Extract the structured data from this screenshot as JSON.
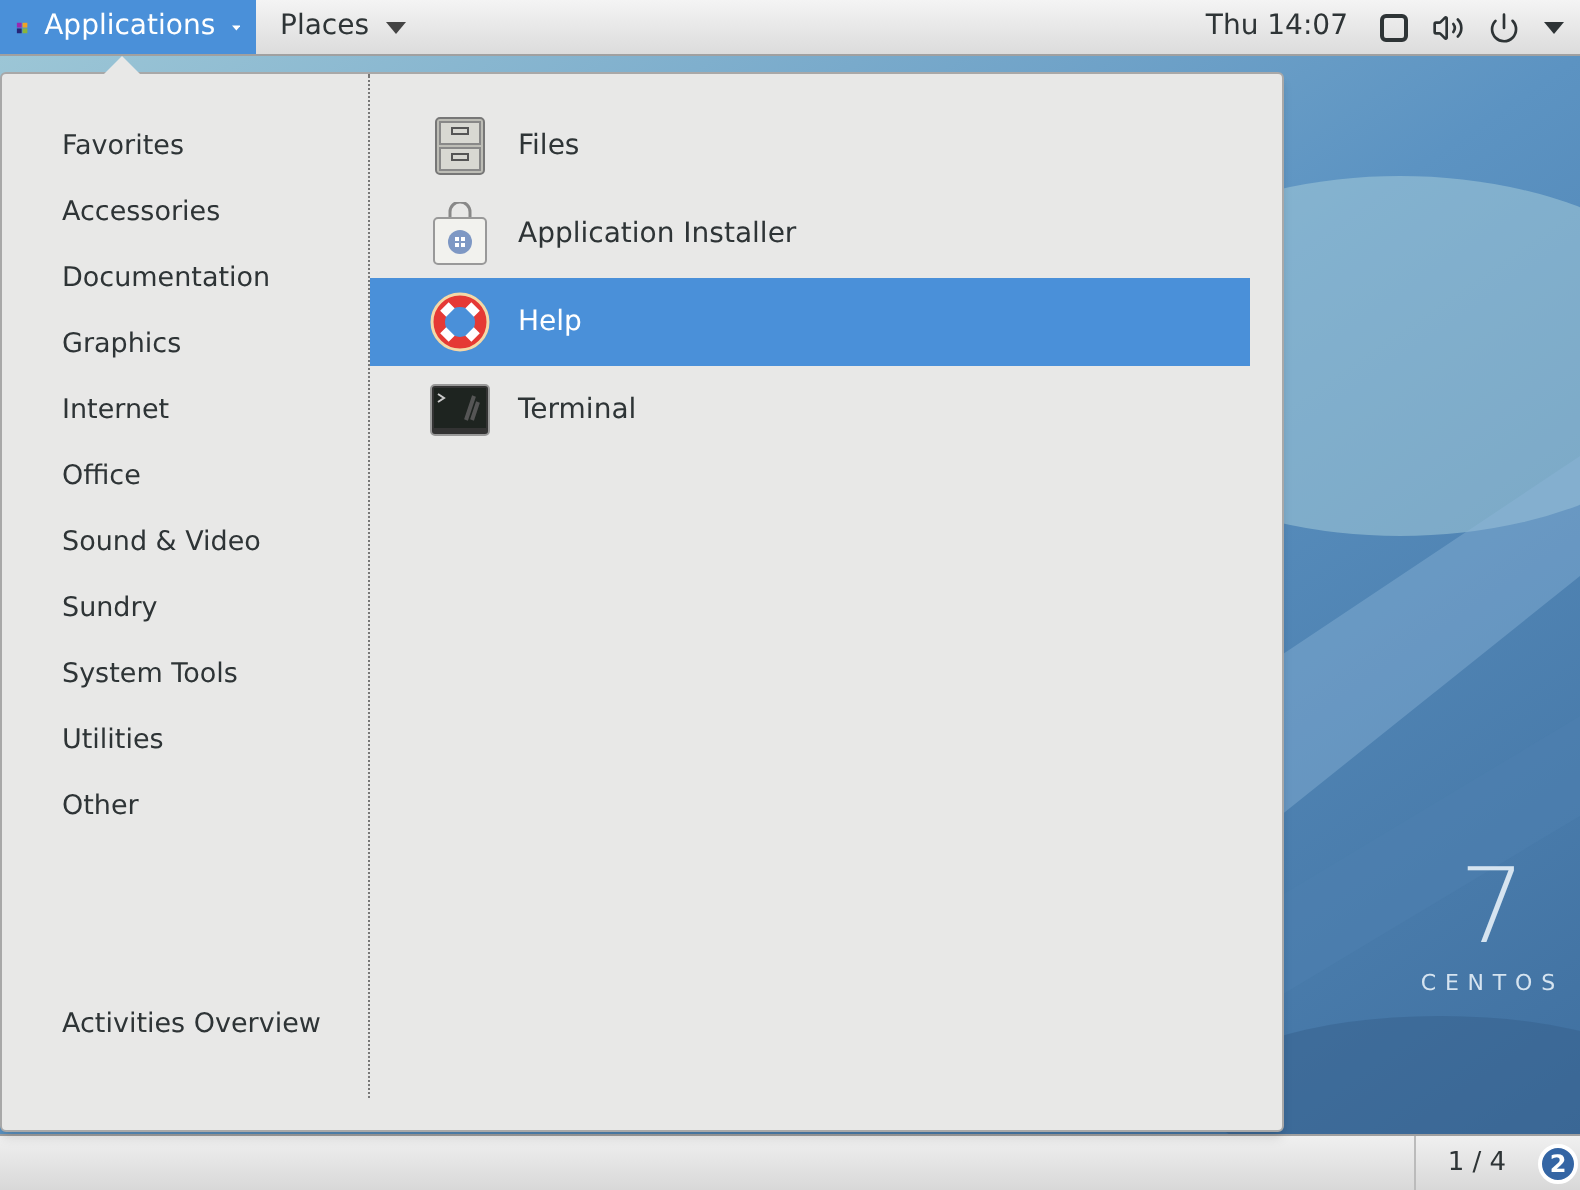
{
  "top_bar": {
    "applications": {
      "label": "Applications",
      "selected": true
    },
    "places": {
      "label": "Places",
      "selected": false
    },
    "clock": "Thu 14:07"
  },
  "menu": {
    "categories": [
      {
        "label": "Favorites"
      },
      {
        "label": "Accessories"
      },
      {
        "label": "Documentation"
      },
      {
        "label": "Graphics"
      },
      {
        "label": "Internet"
      },
      {
        "label": "Office"
      },
      {
        "label": "Sound & Video"
      },
      {
        "label": "Sundry"
      },
      {
        "label": "System Tools"
      },
      {
        "label": "Utilities"
      },
      {
        "label": "Other"
      }
    ],
    "footer": "Activities Overview",
    "apps": [
      {
        "label": "Files",
        "kind": "files",
        "selected": false
      },
      {
        "label": "Application Installer",
        "kind": "installer",
        "selected": false
      },
      {
        "label": "Help",
        "kind": "help",
        "selected": true
      },
      {
        "label": "Terminal",
        "kind": "terminal",
        "selected": false
      }
    ]
  },
  "desktop_logo": {
    "number": "7",
    "name": "CENTOS"
  },
  "bottom_bar": {
    "workspace": "1 / 4",
    "badge": "2"
  }
}
